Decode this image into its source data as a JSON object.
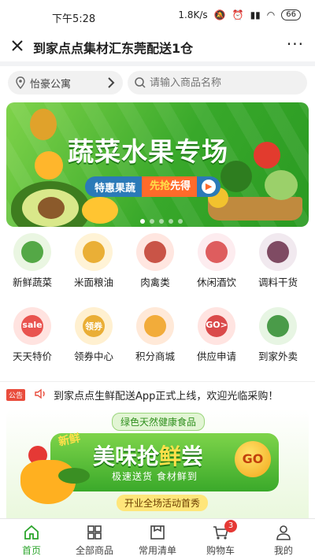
{
  "status": {
    "time": "下午5:28",
    "network_speed": "1.8K/s",
    "battery": "66"
  },
  "navbar": {
    "title": "到家点点集材汇东莞配送1仓",
    "more": "···"
  },
  "location": {
    "label": "怡豪公寓"
  },
  "search": {
    "placeholder": "请输入商品名称"
  },
  "banner": {
    "title": "蔬菜水果专场",
    "pill_a": "特惠果蔬",
    "pill_b": "先抢",
    "pill_c": "先得",
    "page_index": 1,
    "page_count": 5
  },
  "categories": [
    {
      "label": "新鲜蔬菜",
      "icon": "vegetables-icon"
    },
    {
      "label": "米面粮油",
      "icon": "grain-oil-icon"
    },
    {
      "label": "肉禽类",
      "icon": "meat-icon"
    },
    {
      "label": "休闲酒饮",
      "icon": "drinks-icon"
    },
    {
      "label": "调料干货",
      "icon": "seasoning-icon"
    },
    {
      "label": "天天特价",
      "icon": "sale-icon",
      "icon_text": "sale"
    },
    {
      "label": "领券中心",
      "icon": "coupon-icon",
      "icon_text": "领券"
    },
    {
      "label": "积分商城",
      "icon": "points-mall-icon"
    },
    {
      "label": "供应申请",
      "icon": "supply-apply-icon",
      "icon_text": "GO>"
    },
    {
      "label": "到家外卖",
      "icon": "takeaway-icon"
    }
  ],
  "notice": {
    "tag": "公告",
    "text": "到家点点生鲜配送App正式上线，欢迎光临采购！"
  },
  "promo": {
    "top_tag": "绿色天然健康食品",
    "new_tag": "新鲜",
    "title_a": "美味抢",
    "title_hl": "鲜",
    "title_b": "尝",
    "subtitle": "极速送货  食材鲜到",
    "go": "GO",
    "bottom_tag": "开业全场活动首秀"
  },
  "tabbar": {
    "items": [
      {
        "label": "首页",
        "icon": "home-icon",
        "active": true
      },
      {
        "label": "全部商品",
        "icon": "grid-icon"
      },
      {
        "label": "常用清单",
        "icon": "list-icon"
      },
      {
        "label": "购物车",
        "icon": "cart-icon",
        "badge": "3"
      },
      {
        "label": "我的",
        "icon": "user-icon"
      }
    ]
  },
  "colors": {
    "accent": "#2ca52c",
    "badge": "#e53935",
    "banner_green": "#38a82a"
  }
}
